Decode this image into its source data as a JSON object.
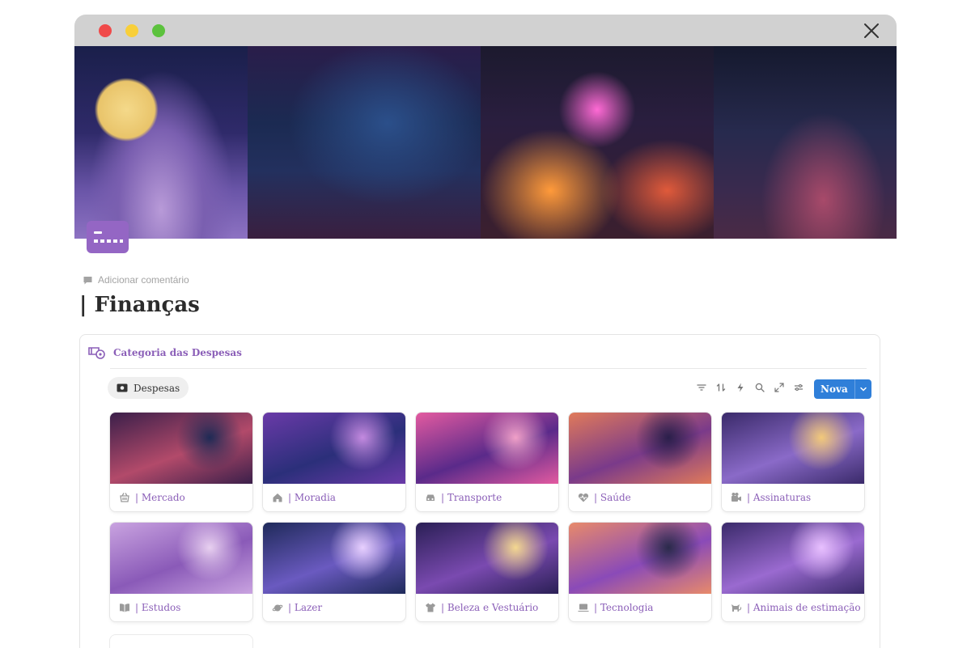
{
  "window": {
    "buttons": [
      "close",
      "minimize",
      "maximize"
    ]
  },
  "page": {
    "icon": "credit-card-icon",
    "add_comment_label": "Adicionar comentário",
    "title": "| Finanças"
  },
  "database": {
    "icon": "money-icon",
    "title": "Categoria das Despesas",
    "view_tab": {
      "icon": "banknote-icon",
      "label": "Despesas"
    },
    "toolbar": {
      "tools": [
        "filter-icon",
        "sort-icon",
        "lightning-icon",
        "search-icon",
        "expand-icon",
        "settings-icon"
      ],
      "new_label": "Nova"
    },
    "cards": [
      {
        "icon": "basket-icon",
        "label": "| Mercado",
        "colors": [
          "#3b1f4a",
          "#b24a6a",
          "#1e2a55"
        ]
      },
      {
        "icon": "house-icon",
        "label": "| Moradia",
        "colors": [
          "#6a3aa8",
          "#2b2f7a",
          "#c48ae0"
        ]
      },
      {
        "icon": "car-icon",
        "label": "| Transporte",
        "colors": [
          "#e35aa0",
          "#5a2a8a",
          "#f0a0c8"
        ]
      },
      {
        "icon": "heart-pulse-icon",
        "label": "| Saúde",
        "colors": [
          "#e07a5a",
          "#7a3a8a",
          "#2a1f4a"
        ]
      },
      {
        "icon": "video-camera-icon",
        "label": "| Assinaturas",
        "colors": [
          "#3a2a6a",
          "#8a6ac8",
          "#f2c97a"
        ]
      },
      {
        "icon": "book-icon",
        "label": "| Estudos",
        "colors": [
          "#c9a3e0",
          "#8a5ab8",
          "#e8d0f0"
        ]
      },
      {
        "icon": "planet-icon",
        "label": "| Lazer",
        "colors": [
          "#1f2a5a",
          "#6a5ac0",
          "#e8d0ff"
        ]
      },
      {
        "icon": "shirt-icon",
        "label": "| Beleza e Vestuário",
        "colors": [
          "#2a1f55",
          "#7a4ab0",
          "#f4d890"
        ]
      },
      {
        "icon": "laptop-icon",
        "label": "| Tecnologia",
        "colors": [
          "#e88a6a",
          "#8a4ab8",
          "#2a2a4a"
        ]
      },
      {
        "icon": "cat-icon",
        "label": "| Animais de estimação",
        "colors": [
          "#3a2a6a",
          "#9a6ad0",
          "#e8c0ff"
        ]
      }
    ]
  }
}
